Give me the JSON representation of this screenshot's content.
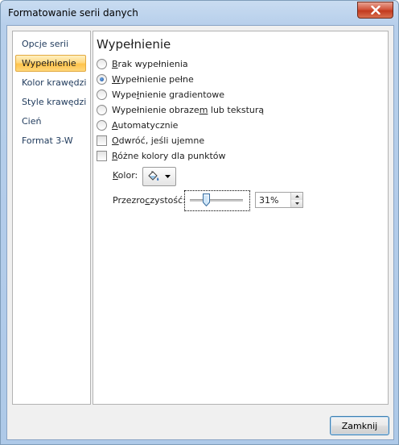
{
  "window": {
    "title": "Formatowanie serii danych"
  },
  "nav": {
    "items": [
      {
        "label": "Opcje serii",
        "active": false
      },
      {
        "label": "Wypełnienie",
        "active": true
      },
      {
        "label": "Kolor krawędzi",
        "active": false
      },
      {
        "label": "Style krawędzi",
        "active": false
      },
      {
        "label": "Cień",
        "active": false
      },
      {
        "label": "Format 3-W",
        "active": false
      }
    ]
  },
  "fill": {
    "title": "Wypełnienie",
    "options": [
      {
        "pre": "",
        "key": "B",
        "post": "rak wypełnienia",
        "checked": false
      },
      {
        "pre": "",
        "key": "W",
        "post": "ypełnienie pełne",
        "checked": true
      },
      {
        "pre": "Wype",
        "key": "ł",
        "post": "nienie gradientowe",
        "checked": false
      },
      {
        "pre": "Wypełnienie obraze",
        "key": "m",
        "post": " lub teksturą",
        "checked": false
      },
      {
        "pre": "",
        "key": "A",
        "post": "utomatycznie",
        "checked": false
      }
    ],
    "checkboxes": [
      {
        "pre": "",
        "key": "O",
        "post": "dwróć, jeśli ujemne",
        "checked": false
      },
      {
        "pre": "",
        "key": "R",
        "post": "óżne kolory dla punktów",
        "checked": false
      }
    ],
    "color_label_key": "K",
    "color_label_rest": "olor:",
    "color_icon": "paint-bucket-icon",
    "transparency_label_pre": "Przezro",
    "transparency_label_key": "c",
    "transparency_label_post": "zystość:",
    "transparency_value": "31%",
    "transparency_percent": 31
  },
  "buttons": {
    "close": "Zamknij"
  }
}
